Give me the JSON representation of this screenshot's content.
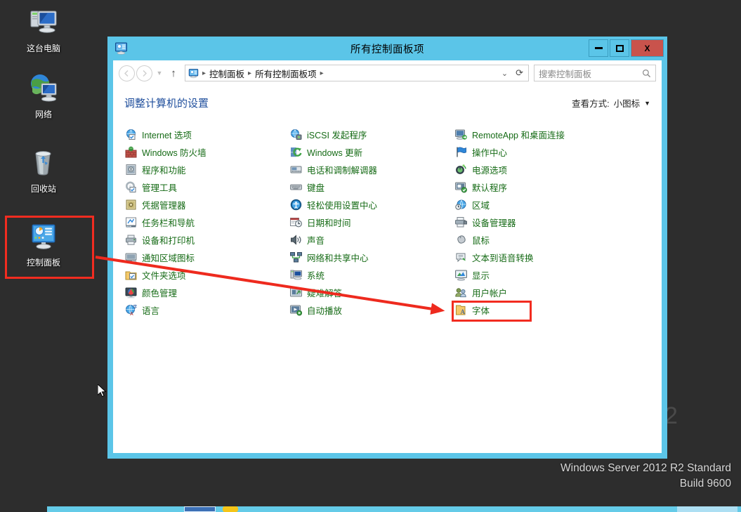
{
  "desktop": {
    "icons": [
      {
        "label": "这台电脑",
        "icon": "computer-icon"
      },
      {
        "label": "网络",
        "icon": "network-icon"
      },
      {
        "label": "回收站",
        "icon": "recycle-bin-icon"
      },
      {
        "label": "控制面板",
        "icon": "control-panel-icon"
      }
    ],
    "watermark_line1": "Windows Server 2012 R2 Standard",
    "watermark_line2": "Build 9600",
    "watermark_partial": "2"
  },
  "window": {
    "title": "所有控制面板项",
    "title_icon": "control-panel-icon",
    "buttons": {
      "minimize": "minimize-icon",
      "maximize": "maximize-icon",
      "close": "X"
    },
    "navbar": {
      "back": "back-icon",
      "forward": "forward-icon",
      "recent": "history-dropdown-icon",
      "up": "up-icon",
      "breadcrumb_icon": "control-panel-icon",
      "breadcrumb": [
        "控制面板",
        "所有控制面板项"
      ],
      "breadcrumb_trailing_sep": "▸",
      "dropdown": "chevron-down-icon",
      "refresh": "refresh-icon"
    },
    "search": {
      "placeholder": "搜索控制面板",
      "icon": "search-icon"
    },
    "content": {
      "page_title": "调整计算机的设置",
      "view_mode_label": "查看方式:",
      "view_mode_value": "小图标",
      "view_mode_caret": "▼",
      "columns": [
        [
          {
            "label": "Internet 选项",
            "icon": "internet-options-icon"
          },
          {
            "label": "Windows 防火墙",
            "icon": "firewall-icon"
          },
          {
            "label": "程序和功能",
            "icon": "programs-features-icon"
          },
          {
            "label": "管理工具",
            "icon": "admin-tools-icon"
          },
          {
            "label": "凭据管理器",
            "icon": "credential-manager-icon"
          },
          {
            "label": "任务栏和导航",
            "icon": "taskbar-navigation-icon"
          },
          {
            "label": "设备和打印机",
            "icon": "devices-printers-icon"
          },
          {
            "label": "通知区域图标",
            "icon": "notification-area-icon"
          },
          {
            "label": "文件夹选项",
            "icon": "folder-options-icon"
          },
          {
            "label": "颜色管理",
            "icon": "color-management-icon"
          },
          {
            "label": "语言",
            "icon": "language-icon"
          }
        ],
        [
          {
            "label": "iSCSI 发起程序",
            "icon": "iscsi-initiator-icon"
          },
          {
            "label": "Windows 更新",
            "icon": "windows-update-icon"
          },
          {
            "label": "电话和调制解调器",
            "icon": "phone-modem-icon"
          },
          {
            "label": "键盘",
            "icon": "keyboard-icon"
          },
          {
            "label": "轻松使用设置中心",
            "icon": "ease-of-access-icon"
          },
          {
            "label": "日期和时间",
            "icon": "date-time-icon"
          },
          {
            "label": "声音",
            "icon": "sound-icon"
          },
          {
            "label": "网络和共享中心",
            "icon": "network-sharing-icon"
          },
          {
            "label": "系统",
            "icon": "system-icon"
          },
          {
            "label": "疑难解答",
            "icon": "troubleshooting-icon"
          },
          {
            "label": "自动播放",
            "icon": "autoplay-icon"
          }
        ],
        [
          {
            "label": "RemoteApp 和桌面连接",
            "icon": "remoteapp-icon"
          },
          {
            "label": "操作中心",
            "icon": "action-center-icon"
          },
          {
            "label": "电源选项",
            "icon": "power-options-icon"
          },
          {
            "label": "默认程序",
            "icon": "default-programs-icon"
          },
          {
            "label": "区域",
            "icon": "region-icon"
          },
          {
            "label": "设备管理器",
            "icon": "device-manager-icon"
          },
          {
            "label": "鼠标",
            "icon": "mouse-icon"
          },
          {
            "label": "文本到语音转换",
            "icon": "text-to-speech-icon"
          },
          {
            "label": "显示",
            "icon": "display-icon"
          },
          {
            "label": "用户帐户",
            "icon": "user-accounts-icon"
          },
          {
            "label": "字体",
            "icon": "fonts-icon"
          }
        ]
      ]
    }
  },
  "annotations": {
    "highlight_color": "#f22c20",
    "arrow_color": "#ee2a1e"
  }
}
